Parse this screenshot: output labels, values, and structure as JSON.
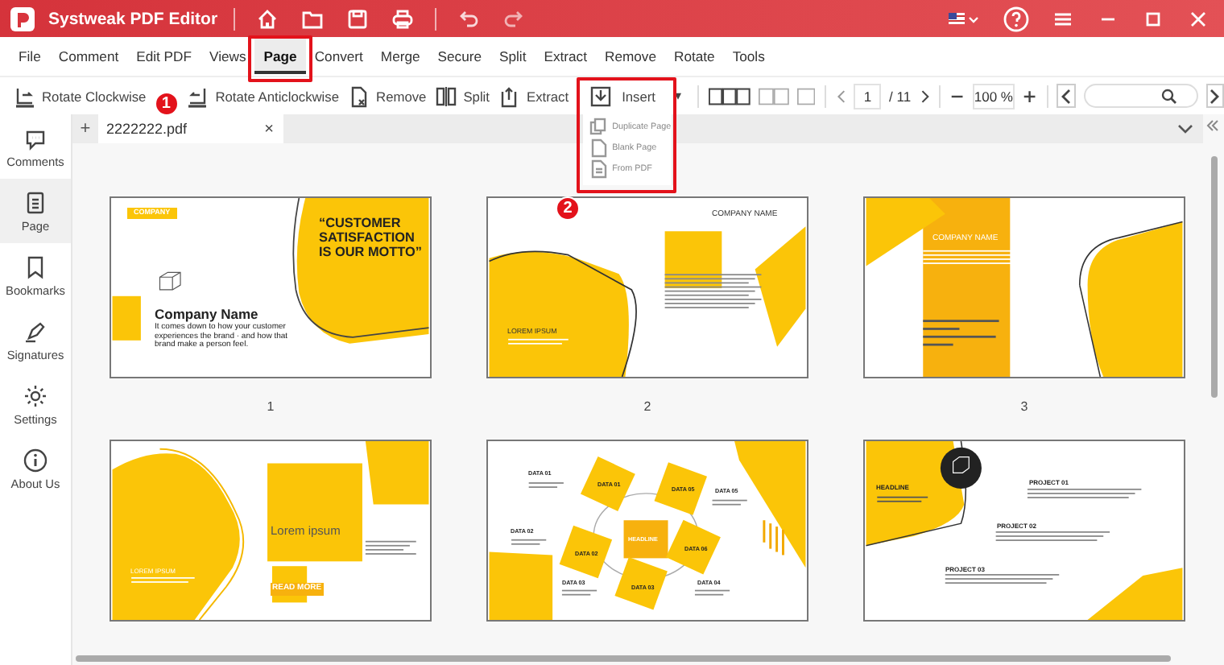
{
  "app": {
    "title": "Systweak PDF Editor"
  },
  "menu": [
    {
      "label": "File",
      "selected": false
    },
    {
      "label": "Comment",
      "selected": false
    },
    {
      "label": "Edit PDF",
      "selected": false
    },
    {
      "label": "Views",
      "selected": false
    },
    {
      "label": "Page",
      "selected": true
    },
    {
      "label": "Convert",
      "selected": false
    },
    {
      "label": "Merge",
      "selected": false
    },
    {
      "label": "Secure",
      "selected": false
    },
    {
      "label": "Split",
      "selected": false
    },
    {
      "label": "Extract",
      "selected": false
    },
    {
      "label": "Remove",
      "selected": false
    },
    {
      "label": "Rotate",
      "selected": false
    },
    {
      "label": "Tools",
      "selected": false
    }
  ],
  "toolbar": [
    {
      "label": "Rotate Clockwise",
      "kind": "rotate-cw"
    },
    {
      "label": "Rotate Anticlockwise",
      "kind": "rotate-ccw"
    },
    {
      "label": "Remove",
      "kind": "remove"
    },
    {
      "label": "Split",
      "kind": "split"
    },
    {
      "label": "Extract",
      "kind": "extract"
    }
  ],
  "insert_menu": {
    "label": "Insert",
    "caret": "▾",
    "expanded": true,
    "items": [
      "Duplicate Page",
      "Blank Page",
      "From PDF"
    ]
  },
  "pager": {
    "page": "1",
    "total": "/ 11",
    "zoom": "100 %"
  },
  "document_tab": {
    "add": "+",
    "name": "2222222.pdf",
    "close": "×"
  },
  "sidebar": [
    {
      "label": "Comments",
      "kind": "comments",
      "selected": false
    },
    {
      "label": "Page",
      "kind": "page",
      "selected": true
    },
    {
      "label": "Bookmarks",
      "kind": "bookmark",
      "selected": false
    },
    {
      "label": "Signatures",
      "kind": "pen",
      "selected": false
    },
    {
      "label": "Settings",
      "kind": "gear",
      "selected": false
    },
    {
      "label": "About Us",
      "kind": "info",
      "selected": false
    }
  ],
  "annotations": [
    {
      "number": "1"
    },
    {
      "number": "2"
    }
  ],
  "thumbnails": [
    {
      "kind": "cover",
      "label": "1",
      "texts": [
        "COMPANY",
        "“CUSTOMER SATISFACTION IS OUR MOTTO”",
        "Company Name",
        "It comes down to how your customer experiences the brand · and how that brand make a person feel."
      ]
    },
    {
      "kind": "split",
      "label": "2",
      "texts": [
        "COMPANY NAME",
        "LOREM IPSUM"
      ]
    },
    {
      "kind": "column",
      "label": "3",
      "texts": [
        "COMPANY NAME"
      ]
    },
    {
      "kind": "lorem",
      "texts": [
        "LOREM IPSUM",
        "Lorem ipsum",
        "READ MORE"
      ]
    },
    {
      "kind": "data",
      "texts": [
        "DATA 01",
        "DATA 01",
        "DATA 05",
        "DATA 05",
        "DATA 02",
        "HEADLINE",
        "DATA 06",
        "DATA 02",
        "DATA 03",
        "DATA 03",
        "DATA 04"
      ]
    },
    {
      "kind": "projects",
      "texts": [
        "HEADLINE",
        "PROJECT 01",
        "PROJECT 02",
        "PROJECT 03"
      ]
    }
  ]
}
